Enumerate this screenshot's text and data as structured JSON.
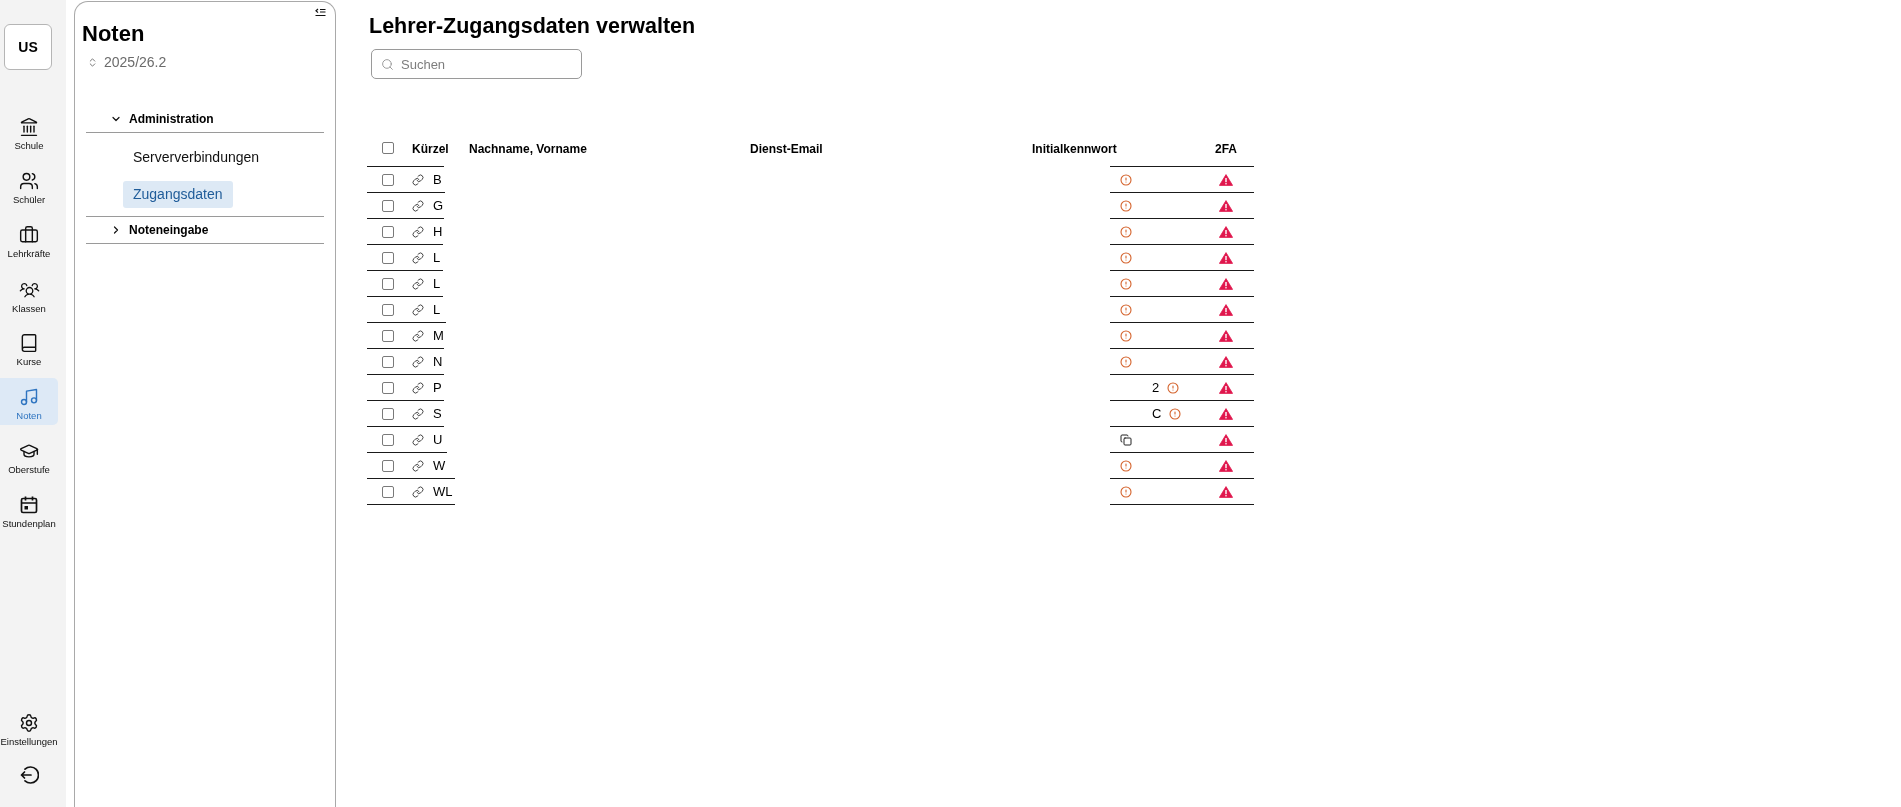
{
  "rail": {
    "avatar": "US",
    "items": [
      {
        "label": "Schule",
        "selected": false
      },
      {
        "label": "Schüler",
        "selected": false
      },
      {
        "label": "Lehrkräfte",
        "selected": false
      },
      {
        "label": "Klassen",
        "selected": false
      },
      {
        "label": "Kurse",
        "selected": false
      },
      {
        "label": "Noten",
        "selected": true
      },
      {
        "label": "Oberstufe",
        "selected": false
      },
      {
        "label": "Stundenplan",
        "selected": false
      }
    ],
    "bottom_items": [
      {
        "label": "Einstellungen"
      }
    ]
  },
  "nav": {
    "title": "Noten",
    "term": "2025/26.2",
    "tree": [
      {
        "label": "Administration",
        "expanded": true,
        "children": [
          {
            "label": "Serververbindungen",
            "selected": false
          },
          {
            "label": "Zugangsdaten",
            "selected": true
          }
        ]
      },
      {
        "label": "Noteneingabe",
        "expanded": false
      }
    ]
  },
  "main": {
    "title": "Lehrer-Zugangsdaten verwalten",
    "search": {
      "placeholder": "Suchen"
    },
    "table": {
      "select_all_checked": false,
      "columns": [
        "Kürzel",
        "Nachname, Vorname",
        "Dienst-Email",
        "Initialkennwort",
        "2FA"
      ],
      "rows": [
        {
          "checked": false,
          "kuerzel": "B",
          "initialkennwort": {
            "kind": "warning"
          },
          "two_factor": false
        },
        {
          "checked": false,
          "kuerzel": "G",
          "initialkennwort": {
            "kind": "warning"
          },
          "two_factor": false
        },
        {
          "checked": false,
          "kuerzel": "H",
          "initialkennwort": {
            "kind": "warning"
          },
          "two_factor": false
        },
        {
          "checked": false,
          "kuerzel": "L",
          "initialkennwort": {
            "kind": "warning"
          },
          "two_factor": false
        },
        {
          "checked": false,
          "kuerzel": "L",
          "initialkennwort": {
            "kind": "warning"
          },
          "two_factor": false
        },
        {
          "checked": false,
          "kuerzel": "L",
          "initialkennwort": {
            "kind": "warning"
          },
          "two_factor": false
        },
        {
          "checked": false,
          "kuerzel": "M",
          "initialkennwort": {
            "kind": "warning"
          },
          "two_factor": false
        },
        {
          "checked": false,
          "kuerzel": "N",
          "initialkennwort": {
            "kind": "warning"
          },
          "two_factor": false
        },
        {
          "checked": false,
          "kuerzel": "P",
          "initialkennwort": {
            "kind": "warning",
            "text": "2"
          },
          "two_factor": false
        },
        {
          "checked": false,
          "kuerzel": "S",
          "initialkennwort": {
            "kind": "warning",
            "text": "C"
          },
          "two_factor": false
        },
        {
          "checked": false,
          "kuerzel": "U",
          "initialkennwort": {
            "kind": "copy"
          },
          "two_factor": false
        },
        {
          "checked": false,
          "kuerzel": "W",
          "initialkennwort": {
            "kind": "warning"
          },
          "two_factor": false
        },
        {
          "checked": false,
          "kuerzel": "WL",
          "initialkennwort": {
            "kind": "warning"
          },
          "two_factor": false
        }
      ]
    }
  }
}
